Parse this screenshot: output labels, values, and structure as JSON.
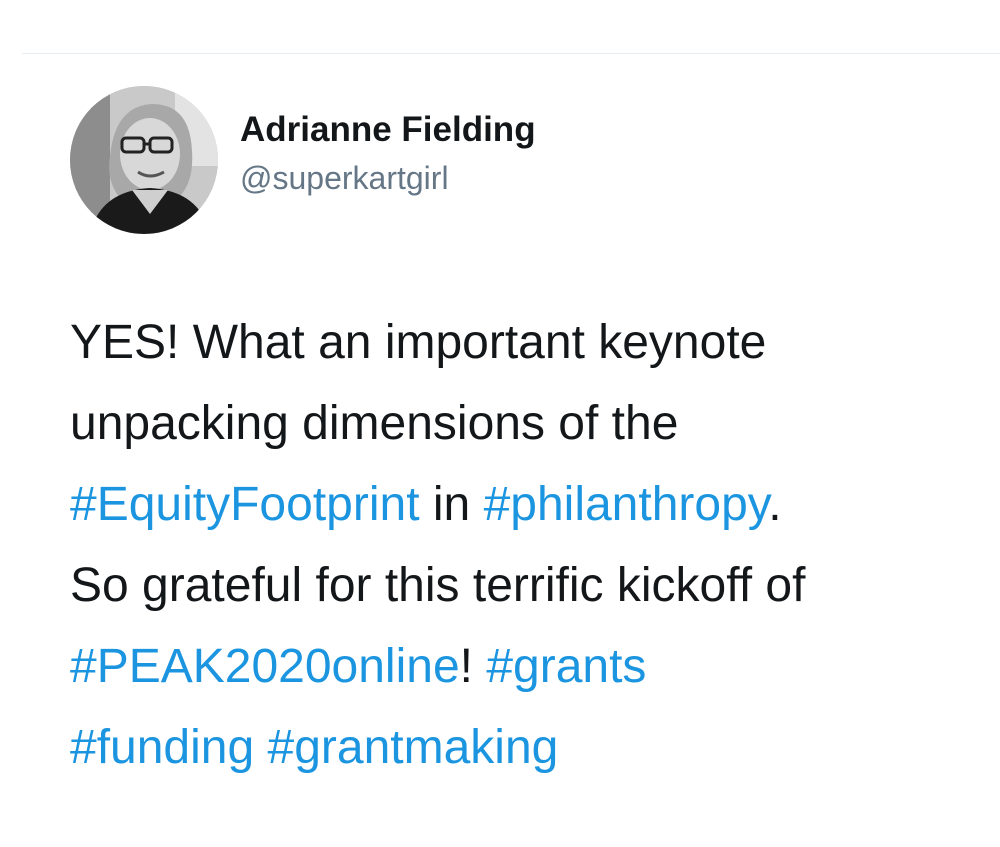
{
  "tweet": {
    "author": {
      "display_name": "Adrianne Fielding",
      "handle": "@superkartgirl"
    },
    "text_lines": [
      [
        {
          "t": "YES! What an important keynote",
          "tag": false
        }
      ],
      [
        {
          "t": "unpacking dimensions of the",
          "tag": false
        }
      ],
      [
        {
          "t": "#EquityFootprint",
          "tag": true
        },
        {
          "t": " in ",
          "tag": false
        },
        {
          "t": "#philanthropy",
          "tag": true
        },
        {
          "t": ".",
          "tag": false
        }
      ],
      [
        {
          "t": "So grateful for this terrific kickoff of",
          "tag": false
        }
      ],
      [
        {
          "t": "#PEAK2020online",
          "tag": true
        },
        {
          "t": "! ",
          "tag": false
        },
        {
          "t": "#grants",
          "tag": true
        }
      ],
      [
        {
          "t": "#funding",
          "tag": true
        },
        {
          "t": " ",
          "tag": false
        },
        {
          "t": "#grantmaking",
          "tag": true
        }
      ]
    ]
  },
  "colors": {
    "text": "#14171a",
    "secondary": "#657786",
    "link": "#1b95e0",
    "divider": "#e6ecf0"
  }
}
